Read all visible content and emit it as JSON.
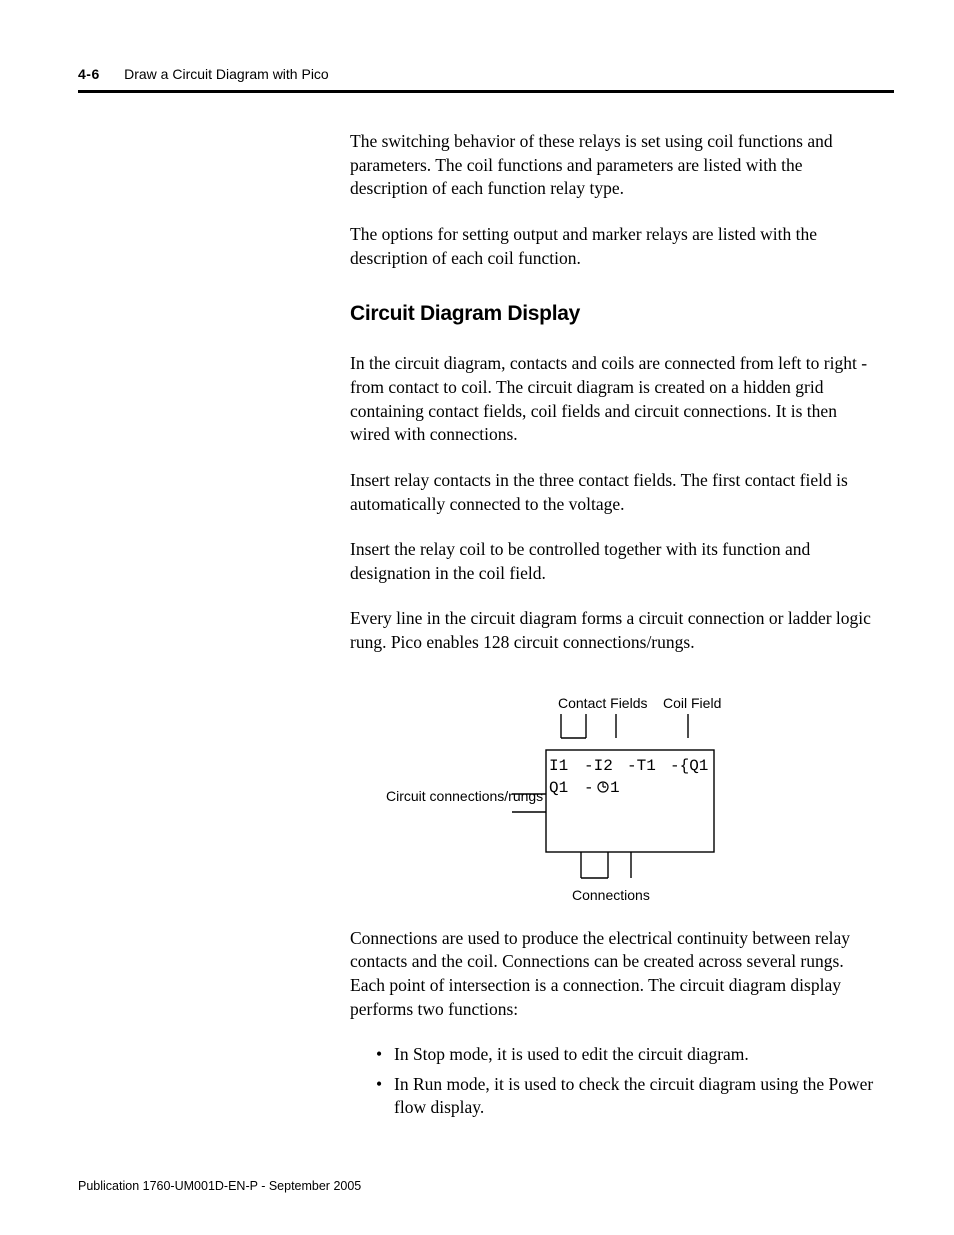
{
  "header": {
    "page_number": "4-6",
    "chapter_title": "Draw a Circuit Diagram with Pico"
  },
  "body": {
    "p1": "The switching behavior of these relays is set using coil functions and parameters. The coil functions and parameters are listed with the description of each function relay type.",
    "p2": "The options for setting output and marker relays are listed with the description of each coil function.",
    "section_heading": "Circuit Diagram Display",
    "p3": "In the circuit diagram, contacts and coils are connected from left to right - from contact to coil. The circuit diagram is created on a hidden grid containing contact fields, coil fields and circuit connections. It is then wired with connections.",
    "p4": "Insert relay contacts in the three contact fields. The first contact field is automatically connected to the voltage.",
    "p5": "Insert the relay coil to be controlled together with its function and designation in the coil field.",
    "p6": "Every line in the circuit diagram forms a circuit connection or ladder logic rung. Pico enables 128 circuit connections/rungs.",
    "p7": "Connections are used to produce the electrical continuity between relay contacts and the coil. Connections can be created across several rungs. Each point of intersection is a connection. The circuit diagram display performs two functions:",
    "li1": "In Stop mode, it is used to edit the circuit diagram.",
    "li2": "In Run mode, it is used to check the circuit diagram using the Power flow display."
  },
  "diagram": {
    "label_contact_fields": "Contact Fields",
    "label_coil_field": "Coil Field",
    "label_rungs": "Circuit connections/rungs",
    "label_connections": "Connections",
    "row1_c1": "I1",
    "row1_c2": "-I2",
    "row1_c3": "-T1",
    "row1_c4": "-{Q1",
    "row2_c1": "Q1",
    "row2_c2a": "-",
    "row2_c2b": "1"
  },
  "footer": {
    "pub": "Publication 1760-UM001D-EN-P - September 2005"
  }
}
